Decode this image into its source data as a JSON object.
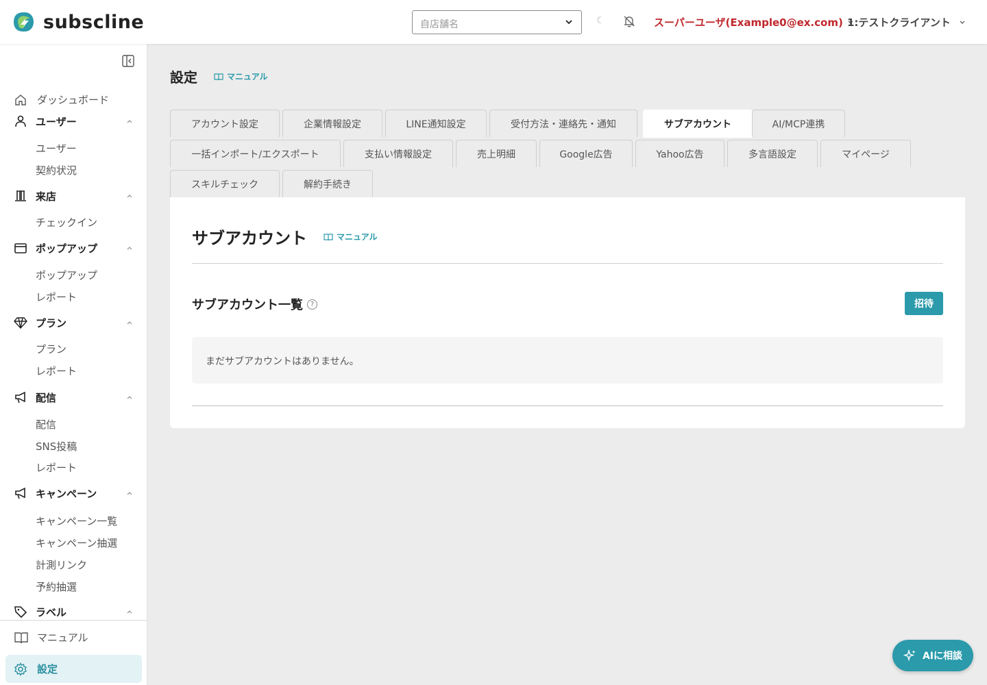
{
  "header": {
    "logo_text": "subscline",
    "store_placeholder": "自店舗名",
    "user_label": "スーパーユーザ(Example0@ex.com)",
    "client_label": "1:テストクライアント"
  },
  "sidebar": {
    "dashboard": "ダッシュボード",
    "sections": [
      {
        "label": "ユーザー",
        "icon": "user-icon",
        "items": [
          "ユーザー",
          "契約状況"
        ]
      },
      {
        "label": "来店",
        "icon": "building-icon",
        "items": [
          "チェックイン"
        ]
      },
      {
        "label": "ポップアップ",
        "icon": "window-icon",
        "items": [
          "ポップアップ",
          "レポート"
        ]
      },
      {
        "label": "プラン",
        "icon": "diamond-icon",
        "items": [
          "プラン",
          "レポート"
        ]
      },
      {
        "label": "配信",
        "icon": "megaphone-icon",
        "items": [
          "配信",
          "SNS投稿",
          "レポート"
        ]
      },
      {
        "label": "キャンペーン",
        "icon": "megaphone-icon",
        "items": [
          "キャンペーン一覧",
          "キャンペーン抽選",
          "計測リンク",
          "予約抽選"
        ]
      },
      {
        "label": "ラベル",
        "icon": "tag-icon",
        "items": []
      }
    ],
    "footer": {
      "manual": "マニュアル",
      "settings": "設定"
    }
  },
  "page": {
    "title": "設定",
    "manual_label": "マニュアル"
  },
  "tabs": {
    "row1": [
      "アカウント設定",
      "企業情報設定",
      "LINE通知設定",
      "受付方法・連絡先・通知",
      "サブアカウント",
      "AI/MCP連携"
    ],
    "row2": [
      "一括インポート/エクスポート",
      "支払い情報設定",
      "売上明細",
      "Google広告",
      "Yahoo広告",
      "多言語設定",
      "マイページ"
    ],
    "row3": [
      "スキルチェック",
      "解約手続き"
    ],
    "active": "サブアカウント"
  },
  "card": {
    "title": "サブアカウント",
    "manual_label": "マニュアル",
    "section_title": "サブアカウント一覧",
    "help_glyph": "?",
    "invite_label": "招待",
    "empty_message": "まだサブアカウントはありません。"
  },
  "ai_button": {
    "label": "AIに相談"
  },
  "colors": {
    "accent": "#2b9aab",
    "user_red": "#c0282d",
    "active_bg": "#e3f2f5"
  }
}
